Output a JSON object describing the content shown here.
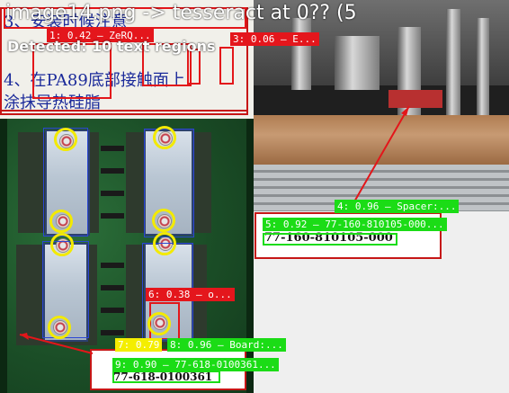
{
  "title_overlay": "image14.png -> tesseract at 0?? (5",
  "status": "Detected: 10 text regions",
  "document": {
    "line1": "3、安装时候注意",
    "line2": "4、在PA89底部接触面上",
    "line3": "涂抹导热硅脂"
  },
  "detections": [
    {
      "label": "1: 0.42 — ZeRQ..."
    },
    {
      "label": "3: 0.06 — E..."
    },
    {
      "label": "4: 0.96 — Spacer:..."
    },
    {
      "label": "5: 0.92 — 77-160-810105-000..."
    },
    {
      "label": "6: 0.38 — o..."
    },
    {
      "label": "7: 0.79"
    },
    {
      "label": "8: 0.96 — Board:..."
    },
    {
      "label": "9: 0.90 — 77-618-0100361..."
    }
  ],
  "part_labels": {
    "spacer_part": "77-160-810105-000",
    "board_part": "77-618-0100361"
  },
  "colors": {
    "red": "#e4161c",
    "green": "#1bdc16",
    "yellow": "#f4ee00",
    "blue_box": "#2b46d4"
  }
}
